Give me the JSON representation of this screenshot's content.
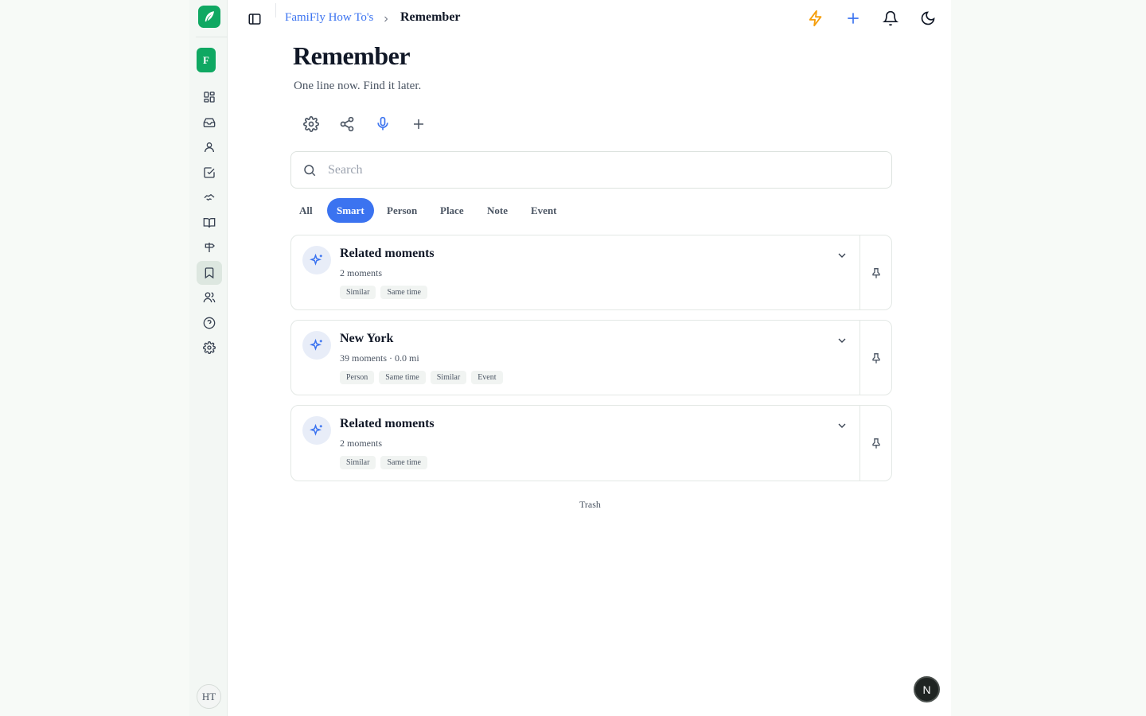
{
  "sidebar": {
    "workspace_initial": "F",
    "user_initials": "HT",
    "items": [
      {
        "name": "dashboard",
        "icon": "grid-icon"
      },
      {
        "name": "inbox",
        "icon": "inbox-icon"
      },
      {
        "name": "contacts",
        "icon": "user-icon"
      },
      {
        "name": "tasks",
        "icon": "checkbox-icon"
      },
      {
        "name": "handshake",
        "icon": "handshake-icon"
      },
      {
        "name": "guides",
        "icon": "book-icon"
      },
      {
        "name": "signpost",
        "icon": "signpost-icon"
      },
      {
        "name": "remember",
        "icon": "bookmark-icon",
        "active": true
      },
      {
        "name": "family",
        "icon": "users-icon"
      },
      {
        "name": "help",
        "icon": "help-circle-icon"
      },
      {
        "name": "settings",
        "icon": "gear-icon"
      }
    ]
  },
  "header": {
    "breadcrumb_parent": "FamiFly How To's",
    "breadcrumb_current": "Remember",
    "accent": "#3b73f0",
    "lightning_color": "#f59e0b"
  },
  "page": {
    "title": "Remember",
    "subtitle": "One line now. Find it later."
  },
  "search": {
    "placeholder": "Search",
    "value": ""
  },
  "filters": [
    {
      "label": "All",
      "active": false
    },
    {
      "label": "Smart",
      "active": true
    },
    {
      "label": "Person",
      "active": false
    },
    {
      "label": "Place",
      "active": false
    },
    {
      "label": "Note",
      "active": false
    },
    {
      "label": "Event",
      "active": false
    }
  ],
  "cards": [
    {
      "title": "Related moments",
      "meta": "2 moments",
      "tags": [
        "Similar",
        "Same time"
      ]
    },
    {
      "title": "New York",
      "meta": "39 moments · 0.0 mi",
      "tags": [
        "Person",
        "Same time",
        "Similar",
        "Event"
      ]
    },
    {
      "title": "Related moments",
      "meta": "2 moments",
      "tags": [
        "Similar",
        "Same time"
      ]
    }
  ],
  "footer": {
    "trash_label": "Trash",
    "fab_label": "N"
  }
}
